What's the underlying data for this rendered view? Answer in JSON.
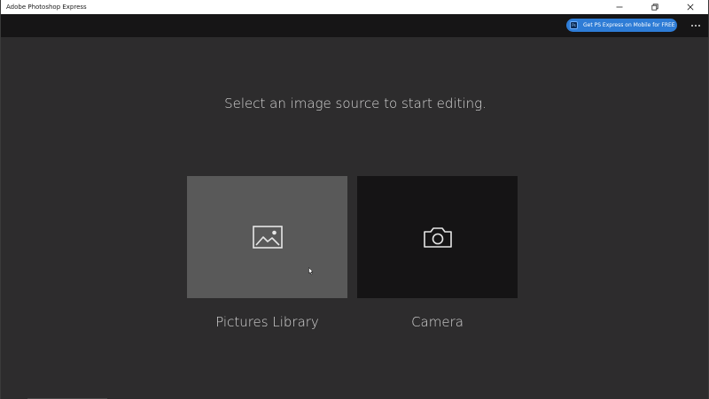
{
  "window": {
    "title": "Adobe Photoshop Express",
    "controls": [
      "minimize",
      "restore",
      "close"
    ]
  },
  "appbar": {
    "promo_badge": "Ps",
    "promo_label": "Get PS Express on Mobile for FREE",
    "more_icon": "ellipsis-icon"
  },
  "main": {
    "prompt": "Select an image source to start editing.",
    "sources": [
      {
        "label": "Pictures Library",
        "icon": "image-icon"
      },
      {
        "label": "Camera",
        "icon": "camera-icon"
      }
    ]
  },
  "colors": {
    "background": "#2d2c2d",
    "appbar": "#161516",
    "promo": "#2e7cd6",
    "tile_selected": "#595959",
    "tile": "#151415",
    "text": "#d6d6d6"
  }
}
